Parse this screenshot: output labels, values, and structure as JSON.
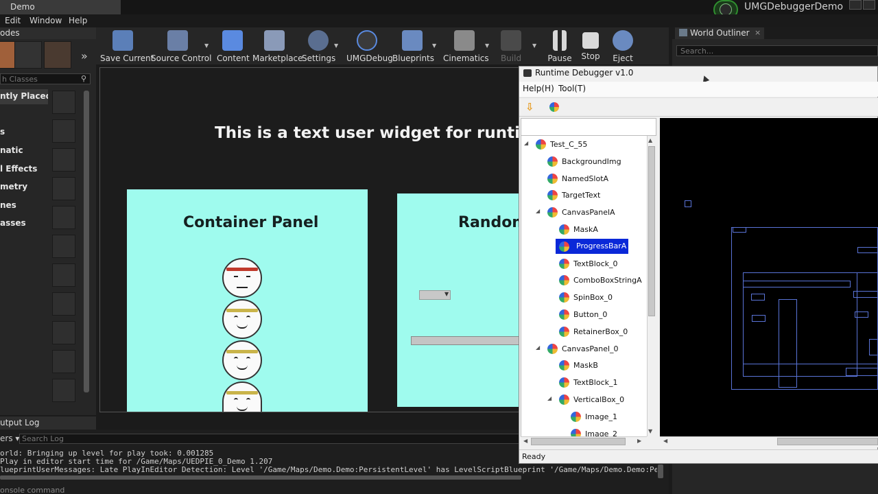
{
  "editor": {
    "tab_title": "Demo",
    "app_name": "UMGDebuggerDemo",
    "menu": [
      "Edit",
      "Window",
      "Help"
    ]
  },
  "modes": {
    "tab_label": "odes",
    "search_placeholder": "h Classes",
    "categories": [
      "ntly Placed",
      "s",
      "natic",
      "l Effects",
      "metry",
      "nes",
      "asses"
    ]
  },
  "toolbar": {
    "buttons": [
      "Save Current",
      "Source Control",
      "Content",
      "Marketplace",
      "Settings",
      "UMGDebug",
      "Blueprints",
      "Cinematics",
      "Build",
      "Pause",
      "Stop",
      "Eject"
    ]
  },
  "viewport": {
    "title": "This is a text user widget for runtime del",
    "container_title": "Container Panel",
    "random_title": "Random"
  },
  "output_log": {
    "tab_label": "utput Log",
    "filters_label": "ers ▾",
    "search_placeholder": "Search Log",
    "lines": [
      "orld: Bringing up level for play took: 0.001285",
      "Play in editor start time for /Game/Maps/UEDPIE_0_Demo 1.207",
      "lueprintUserMessages: Late PlayInEditor Detection: Level '/Game/Maps/Demo.Demo:PersistentLevel' has LevelScriptBlueprint '/Game/Maps/Demo.Demo:Persiste"
    ],
    "console_placeholder": "onsole command"
  },
  "world_outliner": {
    "tab_label": "World Outliner",
    "search_placeholder": "Search..."
  },
  "debugger": {
    "title": "Runtime Debugger v1.0",
    "menu": [
      "Help(H)",
      "Tool(T)"
    ],
    "status": "Ready",
    "tree": [
      {
        "label": "Test_C_55",
        "depth": 0,
        "expanded": true,
        "selected": false
      },
      {
        "label": "BackgroundImg",
        "depth": 1,
        "expanded": null,
        "selected": false
      },
      {
        "label": "NamedSlotA",
        "depth": 1,
        "expanded": null,
        "selected": false
      },
      {
        "label": "TargetText",
        "depth": 1,
        "expanded": null,
        "selected": false
      },
      {
        "label": "CanvasPanelA",
        "depth": 1,
        "expanded": true,
        "selected": false
      },
      {
        "label": "MaskA",
        "depth": 2,
        "expanded": null,
        "selected": false
      },
      {
        "label": "ProgressBarA",
        "depth": 2,
        "expanded": null,
        "selected": true
      },
      {
        "label": "TextBlock_0",
        "depth": 2,
        "expanded": null,
        "selected": false
      },
      {
        "label": "ComboBoxStringA",
        "depth": 2,
        "expanded": null,
        "selected": false
      },
      {
        "label": "SpinBox_0",
        "depth": 2,
        "expanded": null,
        "selected": false
      },
      {
        "label": "Button_0",
        "depth": 2,
        "expanded": null,
        "selected": false
      },
      {
        "label": "RetainerBox_0",
        "depth": 2,
        "expanded": null,
        "selected": false
      },
      {
        "label": "CanvasPanel_0",
        "depth": 1,
        "expanded": true,
        "selected": false
      },
      {
        "label": "MaskB",
        "depth": 2,
        "expanded": null,
        "selected": false
      },
      {
        "label": "TextBlock_1",
        "depth": 2,
        "expanded": null,
        "selected": false
      },
      {
        "label": "VerticalBox_0",
        "depth": 2,
        "expanded": true,
        "selected": false
      },
      {
        "label": "Image_1",
        "depth": 3,
        "expanded": null,
        "selected": false
      },
      {
        "label": "Image_2",
        "depth": 3,
        "expanded": null,
        "selected": false
      }
    ]
  },
  "colors": {
    "panel_bg": "#9ffbee",
    "selection": "#0a28d8",
    "wireframe": "#5a74d8"
  }
}
